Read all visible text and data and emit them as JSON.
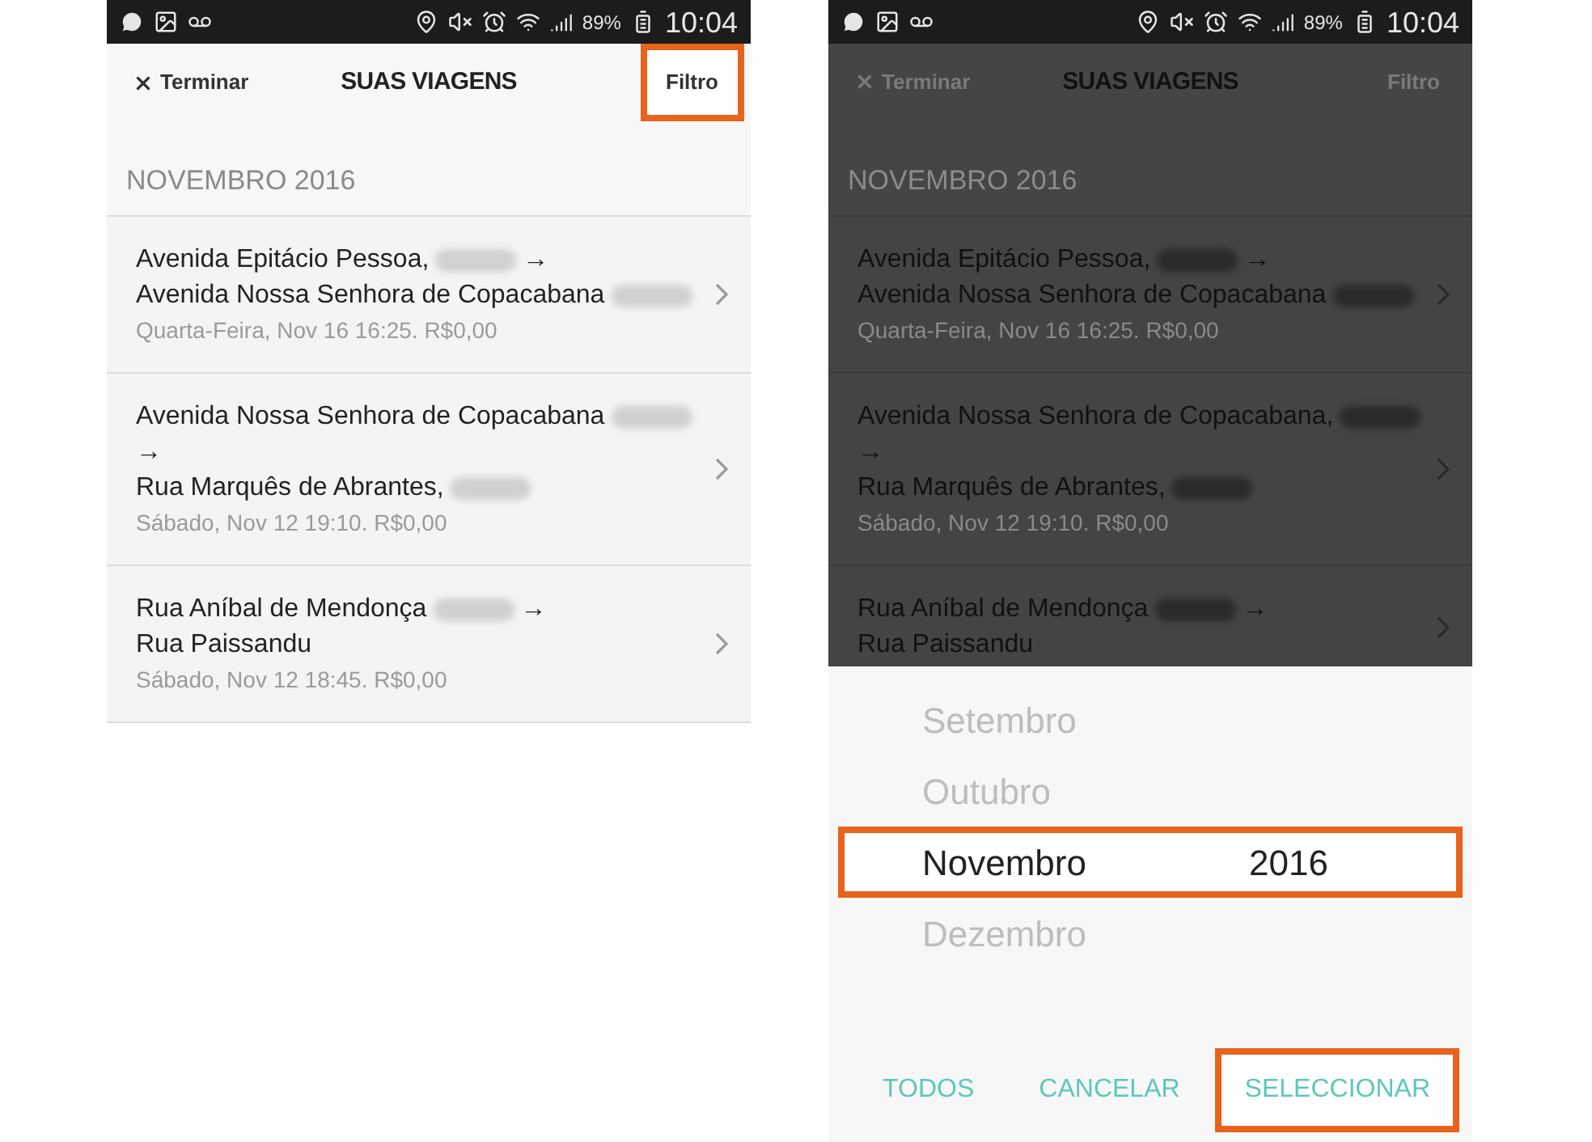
{
  "screens": [
    {
      "status_bar": {
        "battery": "89%",
        "time": "10:04"
      },
      "header": {
        "close": "Terminar",
        "title": "SUAS VIAGENS",
        "filter": {
          "label": "Filtro",
          "highlighted": true
        }
      },
      "dimmed": false,
      "section": "NOVEMBRO 2016",
      "trips": [
        {
          "lines": [
            [
              {
                "kind": "text",
                "text": "Avenida Epitácio Pessoa,"
              },
              {
                "kind": "blur"
              },
              {
                "kind": "text",
                "text": "→"
              }
            ],
            [
              {
                "kind": "text",
                "text": "Avenida Nossa Senhora de Copacabana"
              },
              {
                "kind": "blur"
              }
            ]
          ],
          "date": "Quarta-Feira, Nov 16 16:25. R$0,00"
        },
        {
          "lines": [
            [
              {
                "kind": "text",
                "text": "Avenida Nossa Senhora de Copacabana"
              },
              {
                "kind": "blur"
              }
            ],
            [
              {
                "kind": "text",
                "text": "→"
              }
            ],
            [
              {
                "kind": "text",
                "text": "Rua Marquês de Abrantes,"
              },
              {
                "kind": "blur"
              }
            ]
          ],
          "date": "Sábado, Nov 12 19:10. R$0,00"
        },
        {
          "lines": [
            [
              {
                "kind": "text",
                "text": "Rua Aníbal de Mendonça"
              },
              {
                "kind": "blur"
              },
              {
                "kind": "text",
                "text": "→"
              }
            ],
            [
              {
                "kind": "text",
                "text": "Rua Paissandu"
              }
            ]
          ],
          "date": "Sábado, Nov 12 18:45. R$0,00"
        }
      ]
    },
    {
      "status_bar": {
        "battery": "89%",
        "time": "10:04"
      },
      "header": {
        "close": "Terminar",
        "title": "SUAS VIAGENS",
        "filter": {
          "label": "Filtro",
          "highlighted": false
        }
      },
      "dimmed": true,
      "section": "NOVEMBRO 2016",
      "trips": [
        {
          "lines": [
            [
              {
                "kind": "text",
                "text": "Avenida Epitácio Pessoa,"
              },
              {
                "kind": "blur"
              },
              {
                "kind": "text",
                "text": "→"
              }
            ],
            [
              {
                "kind": "text",
                "text": "Avenida Nossa Senhora de Copacabana"
              },
              {
                "kind": "blur"
              }
            ]
          ],
          "date": "Quarta-Feira, Nov 16 16:25. R$0,00"
        },
        {
          "lines": [
            [
              {
                "kind": "text",
                "text": "Avenida Nossa Senhora de Copacabana,"
              },
              {
                "kind": "blur"
              }
            ],
            [
              {
                "kind": "text",
                "text": "→"
              }
            ],
            [
              {
                "kind": "text",
                "text": "Rua Marquês de Abrantes,"
              },
              {
                "kind": "blur"
              }
            ]
          ],
          "date": "Sábado, Nov 12 19:10. R$0,00"
        },
        {
          "lines": [
            [
              {
                "kind": "text",
                "text": "Rua Aníbal de Mendonça"
              },
              {
                "kind": "blur"
              },
              {
                "kind": "text",
                "text": "→"
              }
            ],
            [
              {
                "kind": "text",
                "text": "Rua Paissandu"
              }
            ]
          ]
        }
      ],
      "picker": {
        "months": [
          {
            "label": "Setembro",
            "selected": false
          },
          {
            "label": "Outubro",
            "selected": false
          },
          {
            "label": "Novembro",
            "selected": true,
            "highlighted": true
          },
          {
            "label": "Dezembro",
            "selected": false
          }
        ],
        "year": "2016",
        "buttons": [
          {
            "label": "TODOS",
            "highlighted": false
          },
          {
            "label": "CANCELAR",
            "highlighted": false
          },
          {
            "label": "SELECCIONAR",
            "highlighted": true
          }
        ]
      }
    }
  ]
}
